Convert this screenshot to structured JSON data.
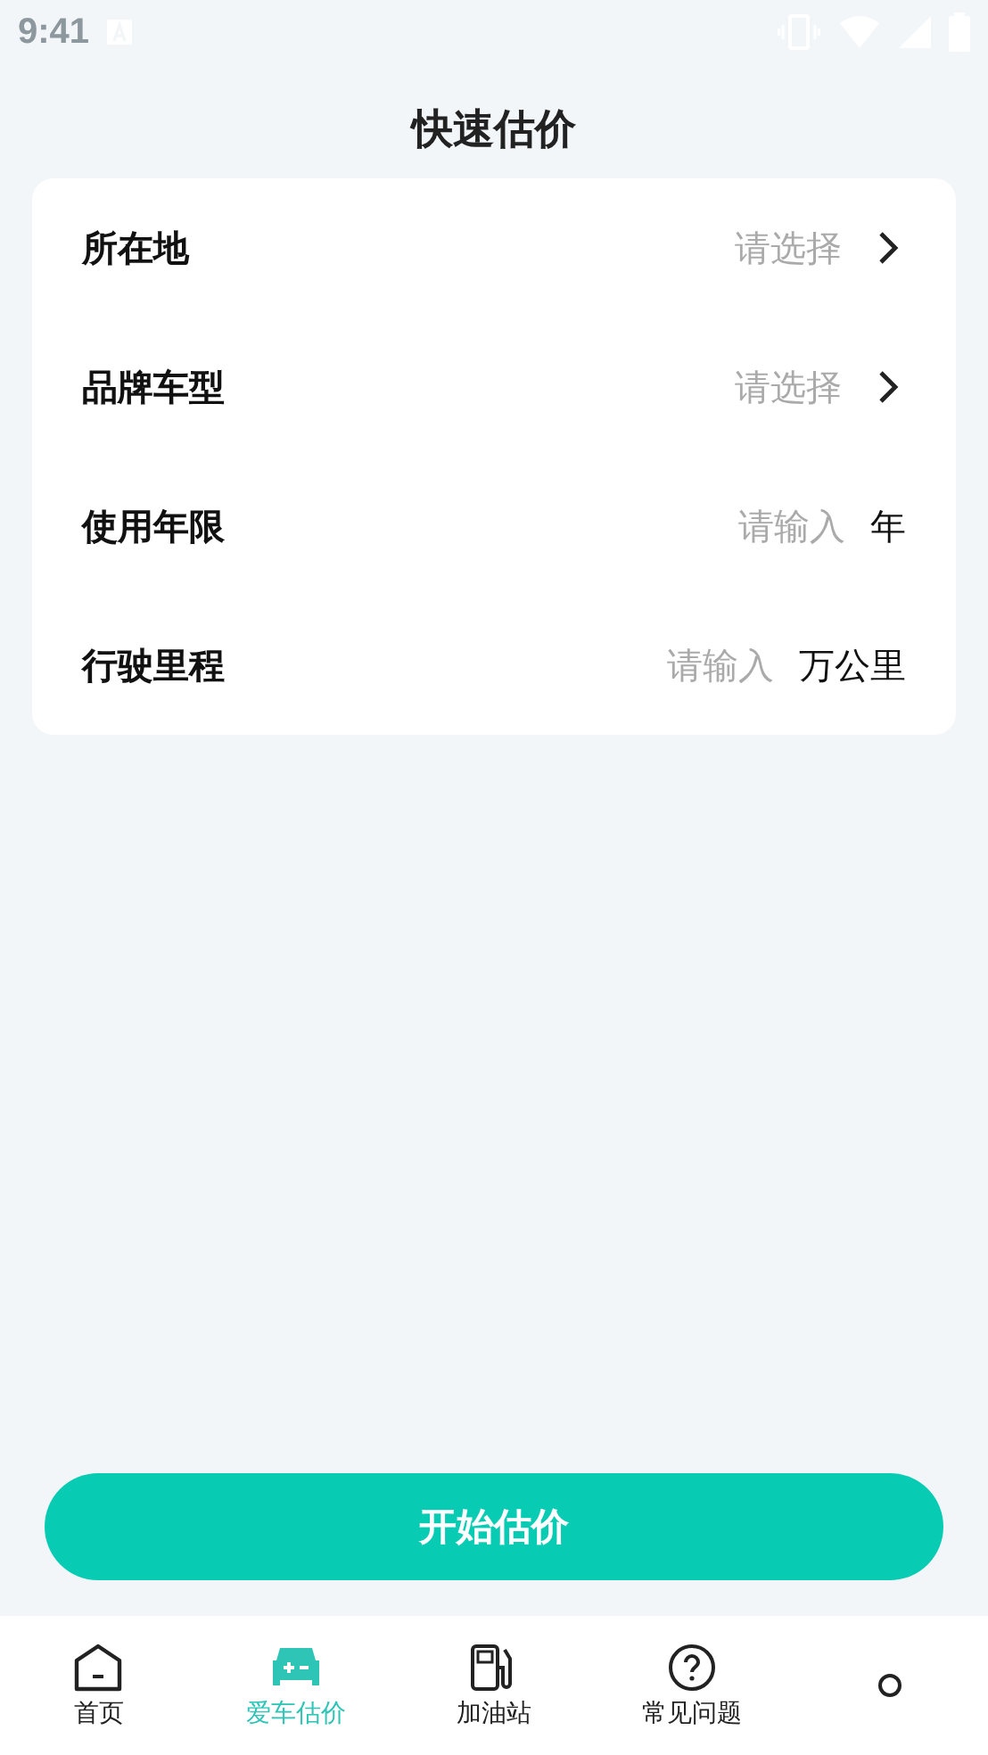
{
  "status_bar": {
    "time": "9:41"
  },
  "title": "快速估价",
  "fields": [
    {
      "kind": "select",
      "label": "所在地",
      "placeholder": "请选择"
    },
    {
      "kind": "select",
      "label": "品牌车型",
      "placeholder": "请选择"
    },
    {
      "kind": "input",
      "label": "使用年限",
      "placeholder": "请输入",
      "unit": "年"
    },
    {
      "kind": "input",
      "label": "行驶里程",
      "placeholder": "请输入",
      "unit": "万公里"
    }
  ],
  "submit_button": "开始估价",
  "tabs": [
    {
      "kind": "home",
      "label": "首页",
      "selected": false
    },
    {
      "kind": "car",
      "label": "爱车估价",
      "selected": true
    },
    {
      "kind": "fuel",
      "label": "加油站",
      "selected": false
    },
    {
      "kind": "help",
      "label": "常见问题",
      "selected": false
    },
    {
      "kind": "dot",
      "selected": false
    }
  ]
}
